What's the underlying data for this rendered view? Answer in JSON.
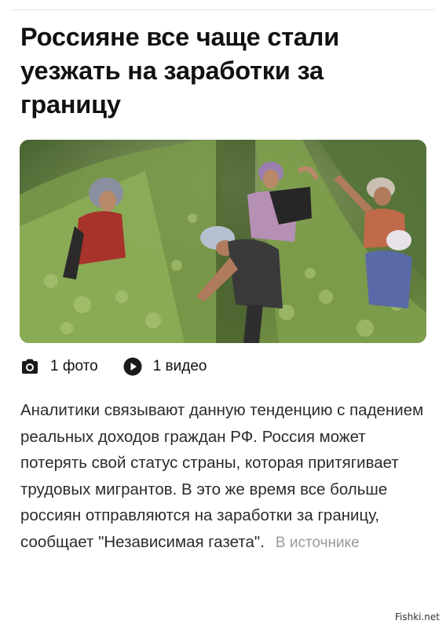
{
  "article": {
    "title": "Россияне все чаще стали уезжать на заработки за границу",
    "media": {
      "photos_label": "1 фото",
      "videos_label": "1 видео",
      "photos_icon": "camera-icon",
      "videos_icon": "play-icon"
    },
    "body": "Аналитики связывают данную тенденцию с падением реальных доходов граждан РФ. Россия может потерять свой статус страны, которая притягивает трудовых мигрантов. В это же время все больше россиян отправляются на заработки за границу, сообщает \"Независимая газета\".",
    "source_link": "В источнике"
  },
  "watermark": "Fishki.net",
  "colors": {
    "text": "#1a1a1a",
    "muted": "#9a9a9a",
    "foliage": "#6e8f43"
  }
}
